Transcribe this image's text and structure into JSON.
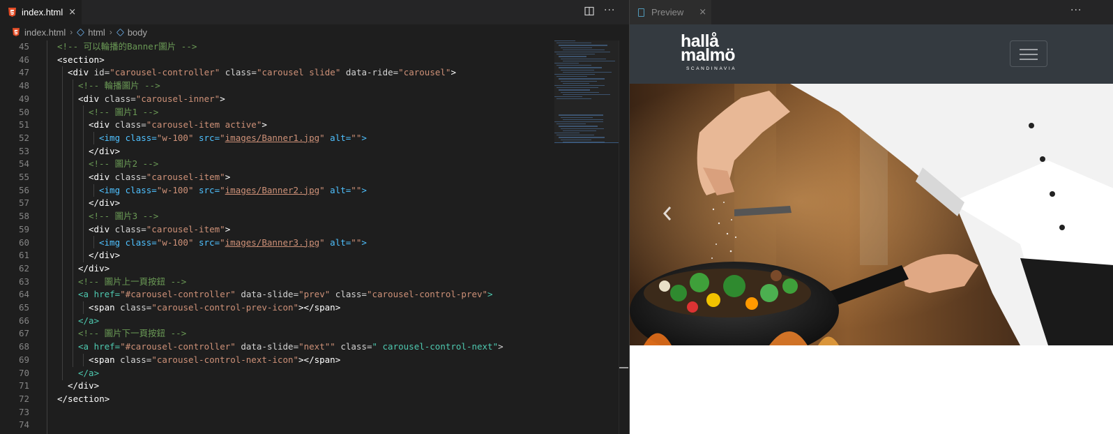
{
  "editor": {
    "tab": {
      "label": "index.html",
      "icon": "html5-icon",
      "close": "×"
    },
    "actions": [
      "split-editor-icon",
      "more-actions-icon"
    ],
    "more_glyph": "···",
    "breadcrumb": [
      {
        "label": "index.html",
        "icon": "html5-icon"
      },
      {
        "label": "html",
        "icon": "symbol-cube-icon"
      },
      {
        "label": "body",
        "icon": "symbol-cube-icon"
      }
    ],
    "breadcrumb_sep": "›",
    "line_numbers": [
      "45",
      "46",
      "47",
      "48",
      "49",
      "50",
      "51",
      "52",
      "53",
      "54",
      "55",
      "56",
      "57",
      "58",
      "59",
      "60",
      "61",
      "62",
      "63",
      "64",
      "65",
      "66",
      "67",
      "68",
      "69",
      "70",
      "71",
      "72",
      "73",
      "74"
    ],
    "code": {
      "l45": "<!-- 可以輪播的Banner圖片 -->",
      "l46": "<section>",
      "l47_open": "<div ",
      "l47_a1": "id=",
      "l47_v1": "\"carousel-controller\"",
      "l47_a2": " class=",
      "l47_v2": "\"carousel slide\"",
      "l47_a3": " data-ride=",
      "l47_v3": "\"carousel\"",
      "l47_close": ">",
      "l48": "<!-- 輪播圖片 -->",
      "l49_open": "<div ",
      "l49_a": "class=",
      "l49_v": "\"carousel-inner\"",
      "l49_close": ">",
      "l50": "<!-- 圖片1 -->",
      "l51_open": "<div ",
      "l51_a": "class=",
      "l51_v": "\"carousel-item active\"",
      "l51_close": ">",
      "l52_open": "<img ",
      "l52_a1": "class=",
      "l52_v1": "\"w-100\"",
      "l52_a2": " src=",
      "l52_q1": "\"",
      "l52_link": "images/Banner1.jpg",
      "l52_q2": "\"",
      "l52_a3": " alt=",
      "l52_v3": "\"\"",
      "l52_close": ">",
      "l53": "</div>",
      "l54": "<!-- 圖片2 -->",
      "l55_open": "<div ",
      "l55_a": "class=",
      "l55_v": "\"carousel-item\"",
      "l55_close": ">",
      "l56_open": "<img ",
      "l56_a1": "class=",
      "l56_v1": "\"w-100\"",
      "l56_a2": " src=",
      "l56_q1": "\"",
      "l56_link": "images/Banner2.jpg",
      "l56_q2": "\"",
      "l56_a3": " alt=",
      "l56_v3": "\"\"",
      "l56_close": ">",
      "l57": "</div>",
      "l58": "<!-- 圖片3 -->",
      "l59_open": "<div ",
      "l59_a": "class=",
      "l59_v": "\"carousel-item\"",
      "l59_close": ">",
      "l60_open": "<img ",
      "l60_a1": "class=",
      "l60_v1": "\"w-100\"",
      "l60_a2": " src=",
      "l60_q1": "\"",
      "l60_link": "images/Banner3.jpg",
      "l60_q2": "\"",
      "l60_a3": " alt=",
      "l60_v3": "\"\"",
      "l60_close": ">",
      "l61": "</div>",
      "l62": "</div>",
      "l63": "<!-- 圖片上一頁按鈕 -->",
      "l64_open": "<a ",
      "l64_a1": "href=",
      "l64_v1": "\"#carousel-controller\"",
      "l64_a2": " data-slide=",
      "l64_v2": "\"prev\"",
      "l64_a3": " class=",
      "l64_v3": "\"carousel-control-prev\"",
      "l64_close": ">",
      "l65_open": "<span ",
      "l65_a": "class=",
      "l65_v": "\"carousel-control-prev-icon\"",
      "l65_close": "></span>",
      "l66": "</a>",
      "l67": "<!-- 圖片下一頁按鈕 -->",
      "l68_open": "<a ",
      "l68_a1": "href=",
      "l68_v1": "\"#carousel-controller\"",
      "l68_a2": " data-slide=",
      "l68_v2": "\"next\"\"",
      "l68_a3": " class=",
      "l68_v3": "\" carousel-control-next\"",
      "l68_close": ">",
      "l69_open": "<span ",
      "l69_a": "class=",
      "l69_v": "\"carousel-control-next-icon\"",
      "l69_close": "></span>",
      "l70": "</a>",
      "l71": "</div>",
      "l72": "</section>"
    }
  },
  "preview": {
    "tab": {
      "label": "Preview",
      "icon": "preview-file-icon",
      "close": "×"
    },
    "more_glyph": "···",
    "site": {
      "logo": {
        "line1": "hallå",
        "line2": "malmö",
        "tagline": "SCANDINAVIA"
      },
      "toggler_icon": "hamburger-menu-icon",
      "banner_icon": "chevron-left-icon"
    }
  },
  "colors": {
    "editor_bg": "#1e1e1e",
    "tab_bar_bg": "#252526",
    "comment": "#6a9955",
    "string": "#ce9178",
    "img_tag": "#4fc1ff",
    "anchor_tag": "#4ec9b0",
    "line_number": "#858585",
    "navbar_bg": "#343a40"
  }
}
